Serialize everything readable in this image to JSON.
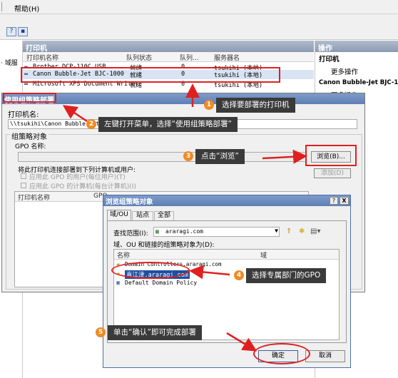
{
  "menu": {
    "item_help": "帮助(H)"
  },
  "left_pane": {
    "label": "· 域服"
  },
  "printers_panel": {
    "title": "打印机",
    "columns": [
      "打印机名称",
      "队列状态",
      "队列...",
      "服务器名"
    ],
    "rows": [
      {
        "name": "Brother DCP-110C USB",
        "status": "就绪",
        "queue": "0",
        "server": "tsukihi (本地)"
      },
      {
        "name": "Canon Bubble-Jet BJC-1000",
        "status": "就绪",
        "queue": "0",
        "server": "tsukihi (本地)"
      },
      {
        "name": "Microsoft XPS Document Writer",
        "status": "就绪",
        "queue": "0",
        "server": "tsukihi (本地)"
      }
    ]
  },
  "actions_panel": {
    "title": "操作",
    "section1": "打印机",
    "more_actions": "更多操作",
    "section2": "Canon Bubble-Jet BJC-1",
    "item2": "更多操作"
  },
  "deploy_dialog": {
    "title": "使用组策略部署",
    "printer_name_label": "打印机名:",
    "printer_name_value": "\\\\tsukihi\\Canon Bubble-Jet BJC-1000",
    "gpo_group": "组策略对象",
    "gpo_name_label": "GPO 名称:",
    "browse_button": "浏览(B)...",
    "deploy_to_label": "将此打印机连接部署到下列计算机或用户:",
    "checkbox_users": "应用此 GPO 的用户(每位用户)(T)",
    "checkbox_computers": "应用此 GPO 的计算机(每台计算机)(I)",
    "add_button": "添加(D)",
    "list_col1": "打印机名称",
    "list_col2": "GPO"
  },
  "browse_dialog": {
    "title": "浏览组策略对象",
    "help_button": "?",
    "close_button": "X",
    "tabs": [
      "域/OU",
      "站点",
      "全部"
    ],
    "look_in_label": "查找范围(I):",
    "look_in_value": "araragi.com",
    "list_caption": "域、OU 和链接的组策略对象为(D):",
    "col_name": "名称",
    "col_domain": "域",
    "items": [
      {
        "name": "Domain Controllers.araragi.com"
      },
      {
        "name": "直江津.araragi.com"
      },
      {
        "name": "Default Domain Policy"
      }
    ],
    "ok_button": "确定",
    "cancel_button": "取消"
  },
  "annotations": [
    {
      "number": "1",
      "text": "选择要部署的打印机"
    },
    {
      "number": "2",
      "text": "左键打开菜单，选择“使用组策略部署”"
    },
    {
      "number": "3",
      "text": "点击“浏览”"
    },
    {
      "number": "4",
      "text": "选择专属部门的GPO"
    },
    {
      "number": "5",
      "text": "单击“确认”即可完成部署"
    }
  ],
  "colors": {
    "highlight": "#e02020",
    "step": "#f08a24",
    "callout_bg": "#3a3a3a",
    "title_bar": "#6a88be"
  }
}
